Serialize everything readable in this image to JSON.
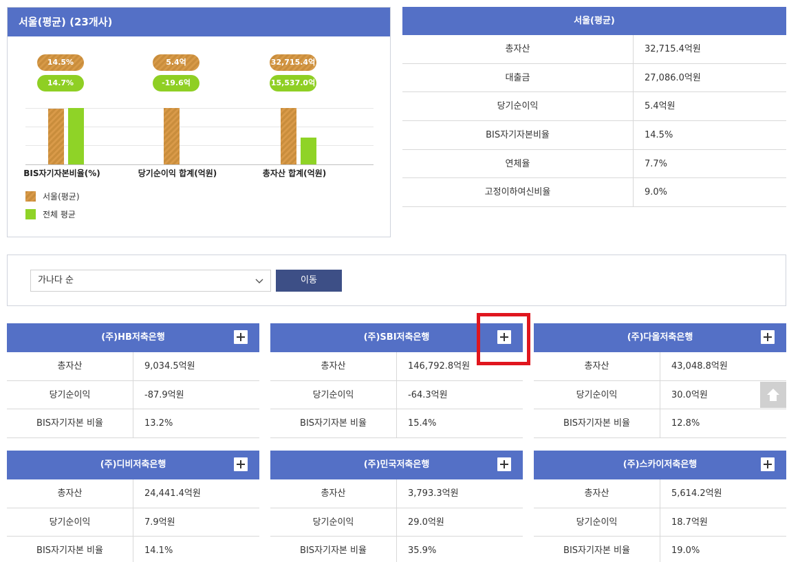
{
  "summary_panel": {
    "title": "서울(평균) (23개사)",
    "chart_data": {
      "type": "bar",
      "categories": [
        "BIS자기자본비율(%)",
        "당기순이익 합계(억원)",
        "총자산 합계(억원)"
      ],
      "series": [
        {
          "name": "서울(평균)",
          "values": [
            14.5,
            5.4,
            32715.4
          ],
          "labels": [
            "14.5%",
            "5.4억",
            "32,715.4억"
          ]
        },
        {
          "name": "전체 평균",
          "values": [
            14.7,
            -19.6,
            15537.0
          ],
          "labels": [
            "14.7%",
            "-19.6억",
            "15,537.0억"
          ]
        }
      ],
      "legend": [
        "서울(평균)",
        "전체 평균"
      ],
      "colors": {
        "seoul": "#d0913f",
        "all": "#8fd327"
      }
    }
  },
  "summary_table": {
    "title": "서울(평균)",
    "rows": [
      {
        "label": "총자산",
        "value": "32,715.4억원"
      },
      {
        "label": "대출금",
        "value": "27,086.0억원"
      },
      {
        "label": "당기순이익",
        "value": "5.4억원"
      },
      {
        "label": "BIS자기자본비율",
        "value": "14.5%"
      },
      {
        "label": "연체율",
        "value": "7.7%"
      },
      {
        "label": "고정이하여신비율",
        "value": "9.0%"
      }
    ]
  },
  "filter": {
    "sort_select_value": "가나다 순",
    "go_button": "이동"
  },
  "banks": [
    {
      "name": "(주)HB저축은행",
      "rows": [
        {
          "label": "총자산",
          "value": "9,034.5억원"
        },
        {
          "label": "당기순이익",
          "value": "-87.9억원"
        },
        {
          "label": "BIS자기자본 비율",
          "value": "13.2%"
        }
      ]
    },
    {
      "name": "(주)SBI저축은행",
      "rows": [
        {
          "label": "총자산",
          "value": "146,792.8억원"
        },
        {
          "label": "당기순이익",
          "value": "-64.3억원"
        },
        {
          "label": "BIS자기자본 비율",
          "value": "15.4%"
        }
      ]
    },
    {
      "name": "(주)다올저축은행",
      "rows": [
        {
          "label": "총자산",
          "value": "43,048.8억원"
        },
        {
          "label": "당기순이익",
          "value": "30.0억원"
        },
        {
          "label": "BIS자기자본 비율",
          "value": "12.8%"
        }
      ]
    },
    {
      "name": "(주)디비저축은행",
      "rows": [
        {
          "label": "총자산",
          "value": "24,441.4억원"
        },
        {
          "label": "당기순이익",
          "value": "7.9억원"
        },
        {
          "label": "BIS자기자본 비율",
          "value": "14.1%"
        }
      ]
    },
    {
      "name": "(주)민국저축은행",
      "rows": [
        {
          "label": "총자산",
          "value": "3,793.3억원"
        },
        {
          "label": "당기순이익",
          "value": "29.0억원"
        },
        {
          "label": "BIS자기자본 비율",
          "value": "35.9%"
        }
      ]
    },
    {
      "name": "(주)스카이저축은행",
      "rows": [
        {
          "label": "총자산",
          "value": "5,614.2억원"
        },
        {
          "label": "당기순이익",
          "value": "18.7억원"
        },
        {
          "label": "BIS자기자본 비율",
          "value": "19.0%"
        }
      ]
    }
  ],
  "icons": {
    "plus": "plus-icon",
    "scroll_top": "arrow-up-icon",
    "dropdown": "chevron-down-icon"
  }
}
